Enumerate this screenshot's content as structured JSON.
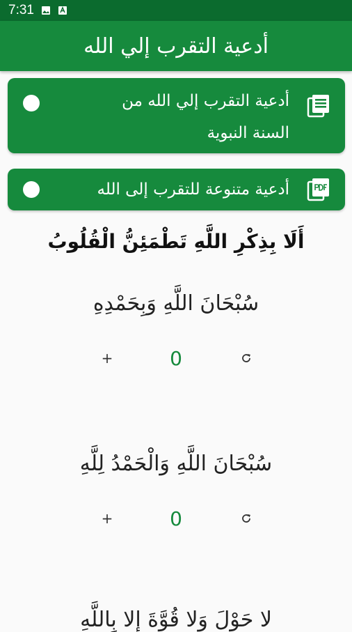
{
  "status_bar": {
    "time": "7:31",
    "icons": [
      "image-icon",
      "app-notification-icon"
    ]
  },
  "app_bar": {
    "title": "أدعية التقرب إلي الله"
  },
  "options": [
    {
      "label": "أدعية التقرب إلي الله من السنة النبوية",
      "icon": "book-list-icon"
    },
    {
      "label": "أدعية متنوعة للتقرب إلى الله",
      "icon": "pdf-icon"
    }
  ],
  "verse": "أَلَا بِذِكْرِ اللَّهِ تَطْمَئِنُّ الْقُلُوبُ",
  "dhikr": [
    {
      "text": "سُبْحَانَ اللَّهِ وَبِحَمْدِهِ",
      "count": "0",
      "plus": "+"
    },
    {
      "text": "سُبْحَانَ اللَّهِ وَالْحَمْدُ لِلَّهِ",
      "count": "0",
      "plus": "+"
    },
    {
      "text": "لا حَوْلَ وَلا قُوَّةَ إِلا بِاللَّهِ"
    }
  ],
  "colors": {
    "status_bar": "#0b6b2e",
    "primary": "#168a3d",
    "background": "#fafafa",
    "counter": "#168a3d"
  }
}
